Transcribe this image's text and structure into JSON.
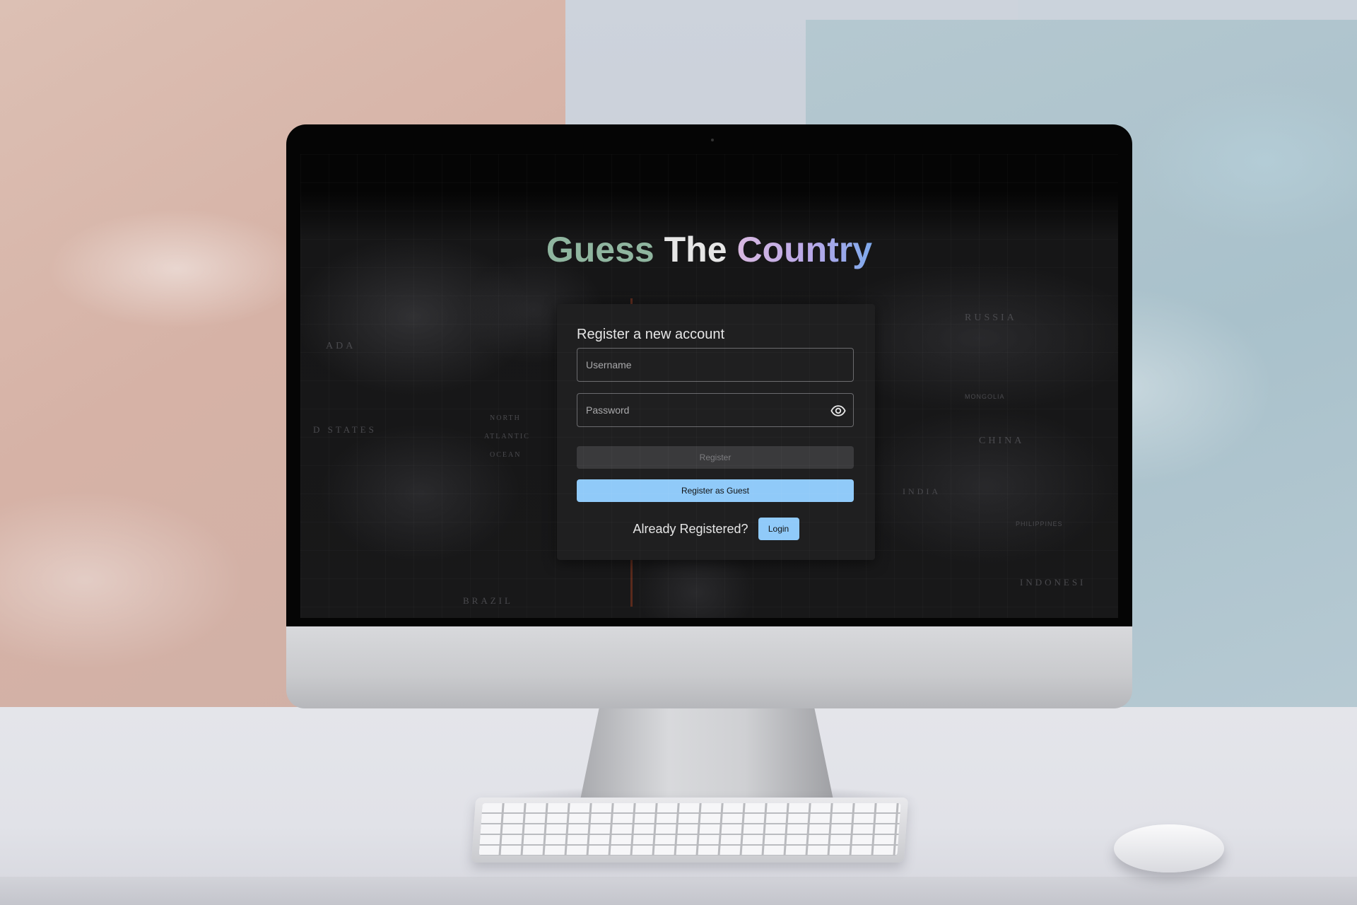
{
  "app": {
    "title_part1": "Guess",
    "title_part2": "The",
    "title_part3": "Country"
  },
  "map_labels": {
    "russia": "RUSSIA",
    "china": "CHINA",
    "india": "INDIA",
    "united_states": "D STATES",
    "canada": "ADA",
    "north_atlantic_1": "NORTH",
    "north_atlantic_2": "ATLANTIC",
    "north_atlantic_3": "OCEAN",
    "brazil": "BRAZIL",
    "indonesia": "INDONESI",
    "mongolia": "MONGOLIA",
    "philippines": "PHILIPPINES"
  },
  "register_form": {
    "heading": "Register a new account",
    "username": {
      "placeholder": "Username",
      "value": ""
    },
    "password": {
      "placeholder": "Password",
      "value": ""
    },
    "register_label": "Register",
    "guest_label": "Register as Guest",
    "already_registered": "Already Registered?",
    "login_label": "Login"
  },
  "colors": {
    "accent": "#90caf9",
    "card_background": "#1f1f20",
    "title_green": "#8fb59f",
    "title_gradient_start": "#d8b8e0",
    "title_gradient_end": "#7ea9ec"
  },
  "icons": {
    "password_toggle": "eye-icon"
  }
}
